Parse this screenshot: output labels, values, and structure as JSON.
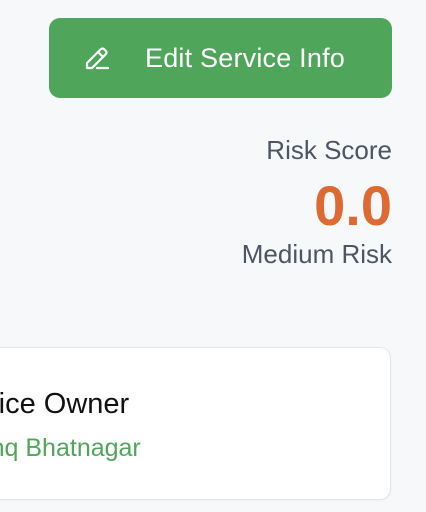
{
  "header": {
    "edit_button_label": "Edit Service Info",
    "edit_icon": "pencil-icon"
  },
  "risk": {
    "label": "Risk Score",
    "score": "0.0",
    "level": "Medium Risk",
    "score_color": "#dd6a33"
  },
  "owner_card": {
    "title": "Service Owner",
    "name": "Anishq Bhatnagar",
    "name_color": "#4fa65b"
  },
  "colors": {
    "accent": "#4fa65b",
    "background": "#f7f8fa"
  }
}
